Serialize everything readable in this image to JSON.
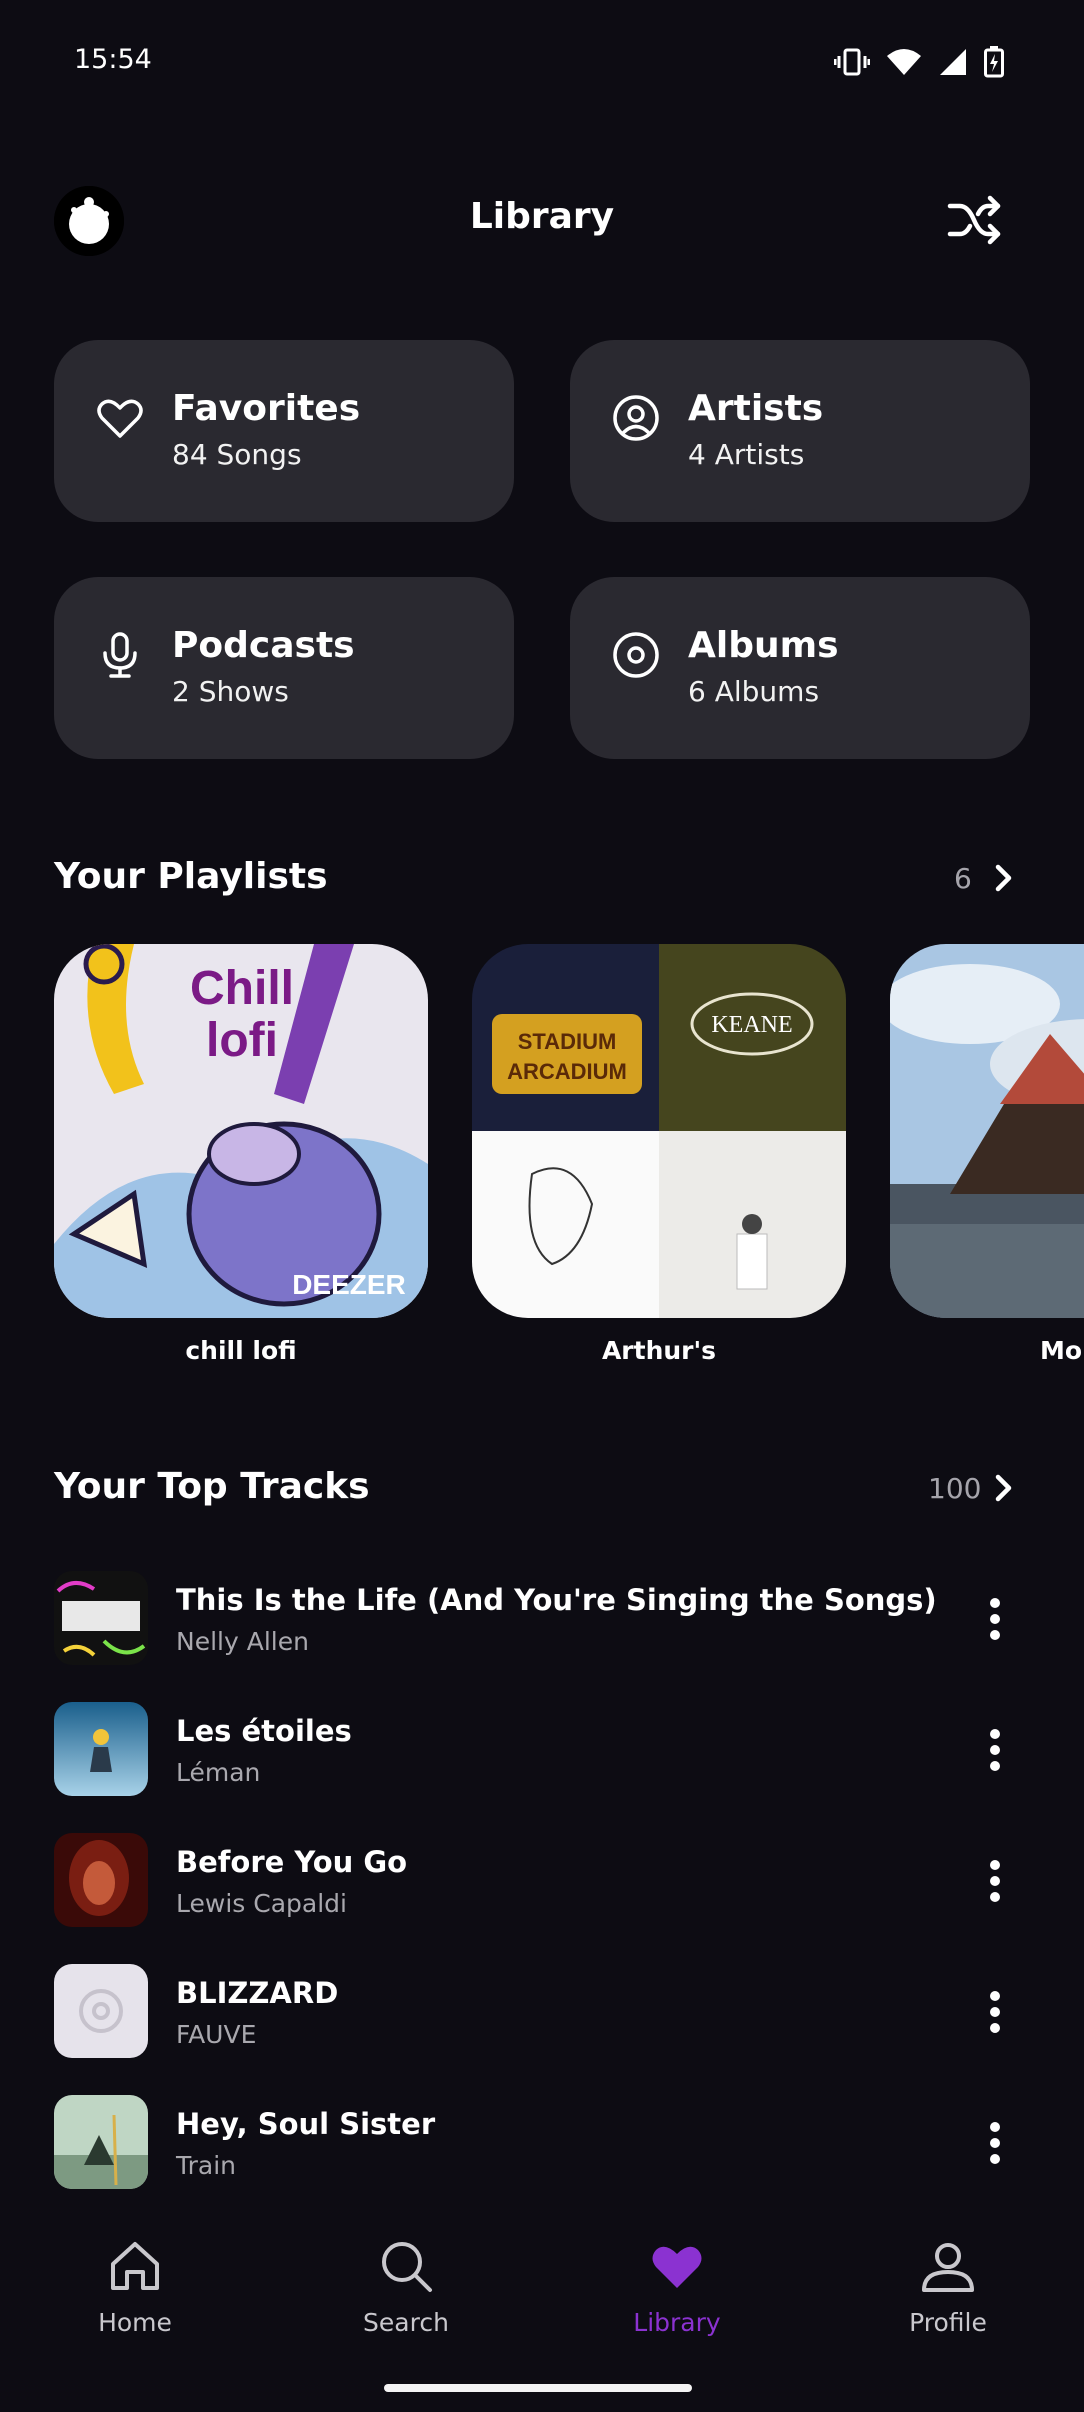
{
  "status_bar": {
    "time": "15:54"
  },
  "header": {
    "title": "Library"
  },
  "categories": [
    {
      "title": "Favorites",
      "subtitle": "84 Songs",
      "icon": "heart-icon"
    },
    {
      "title": "Artists",
      "subtitle": "4 Artists",
      "icon": "artist-icon"
    },
    {
      "title": "Podcasts",
      "subtitle": "2 Shows",
      "icon": "microphone-icon"
    },
    {
      "title": "Albums",
      "subtitle": "6 Albums",
      "icon": "disc-icon"
    }
  ],
  "playlists": {
    "title": "Your Playlists",
    "count": "6",
    "items": [
      {
        "name": "chill lofi",
        "cover_text_1": "Chill",
        "cover_text_2": "lofi",
        "cover_badge": "DEEZER"
      },
      {
        "name": "Arthur's",
        "cover_text_1": "STADIUM",
        "cover_text_2": "ARCADIUM",
        "cover_text_3": "KEANE"
      },
      {
        "name": "Mo"
      }
    ]
  },
  "top_tracks": {
    "title": "Your Top Tracks",
    "count": "100",
    "items": [
      {
        "title": "This Is the Life (And You're Singing the Songs)",
        "artist": "Nelly Allen"
      },
      {
        "title": "Les étoiles",
        "artist": "Léman"
      },
      {
        "title": "Before You Go",
        "artist": "Lewis Capaldi"
      },
      {
        "title": "BLIZZARD",
        "artist": "FAUVE"
      },
      {
        "title": "Hey, Soul Sister",
        "artist": "Train"
      }
    ]
  },
  "nav": {
    "items": [
      {
        "label": "Home",
        "icon": "home-icon"
      },
      {
        "label": "Search",
        "icon": "search-icon"
      },
      {
        "label": "Library",
        "icon": "heart-icon",
        "active": true
      },
      {
        "label": "Profile",
        "icon": "profile-icon"
      }
    ]
  },
  "colors": {
    "background": "#0d0c13",
    "card": "#2a2930",
    "accent": "#8b32d1"
  }
}
